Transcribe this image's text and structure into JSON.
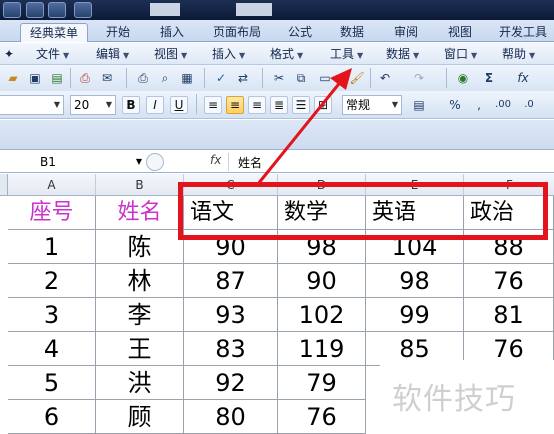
{
  "ribbon_tabs": [
    "经典菜单",
    "开始",
    "插入",
    "页面布局",
    "公式",
    "数据",
    "审阅",
    "视图",
    "开发工具"
  ],
  "menu_items": [
    "文件",
    "编辑",
    "视图",
    "插入",
    "格式",
    "工具",
    "数据",
    "窗口",
    "帮助"
  ],
  "toolbar": {
    "font_size": "20",
    "number_format": "常规",
    "bold": "B",
    "italic": "I",
    "underline": "U",
    "percent": "%",
    "comma": ",",
    "sum": "Σ",
    "fx": "fx"
  },
  "formula_bar": {
    "name_box": "B1",
    "fx_label": "fx",
    "content": "姓名"
  },
  "columns": [
    "A",
    "B",
    "C",
    "D",
    "E",
    "F"
  ],
  "table": {
    "headers": [
      "座号",
      "姓名",
      "语文",
      "数学",
      "英语",
      "政治"
    ],
    "rows": [
      [
        "1",
        "陈",
        "90",
        "98",
        "104",
        "88"
      ],
      [
        "2",
        "林",
        "87",
        "90",
        "98",
        "76"
      ],
      [
        "3",
        "李",
        "93",
        "102",
        "99",
        "81"
      ],
      [
        "4",
        "王",
        "83",
        "119",
        "85",
        "76"
      ],
      [
        "5",
        "洪",
        "92",
        "79",
        "",
        ""
      ],
      [
        "6",
        "顾",
        "80",
        "76",
        "",
        ""
      ]
    ]
  },
  "watermark": "软件技巧",
  "colors": {
    "highlight": "#e3141c",
    "header_text": "#cc33cc",
    "title_bar": "#0c1a36"
  }
}
